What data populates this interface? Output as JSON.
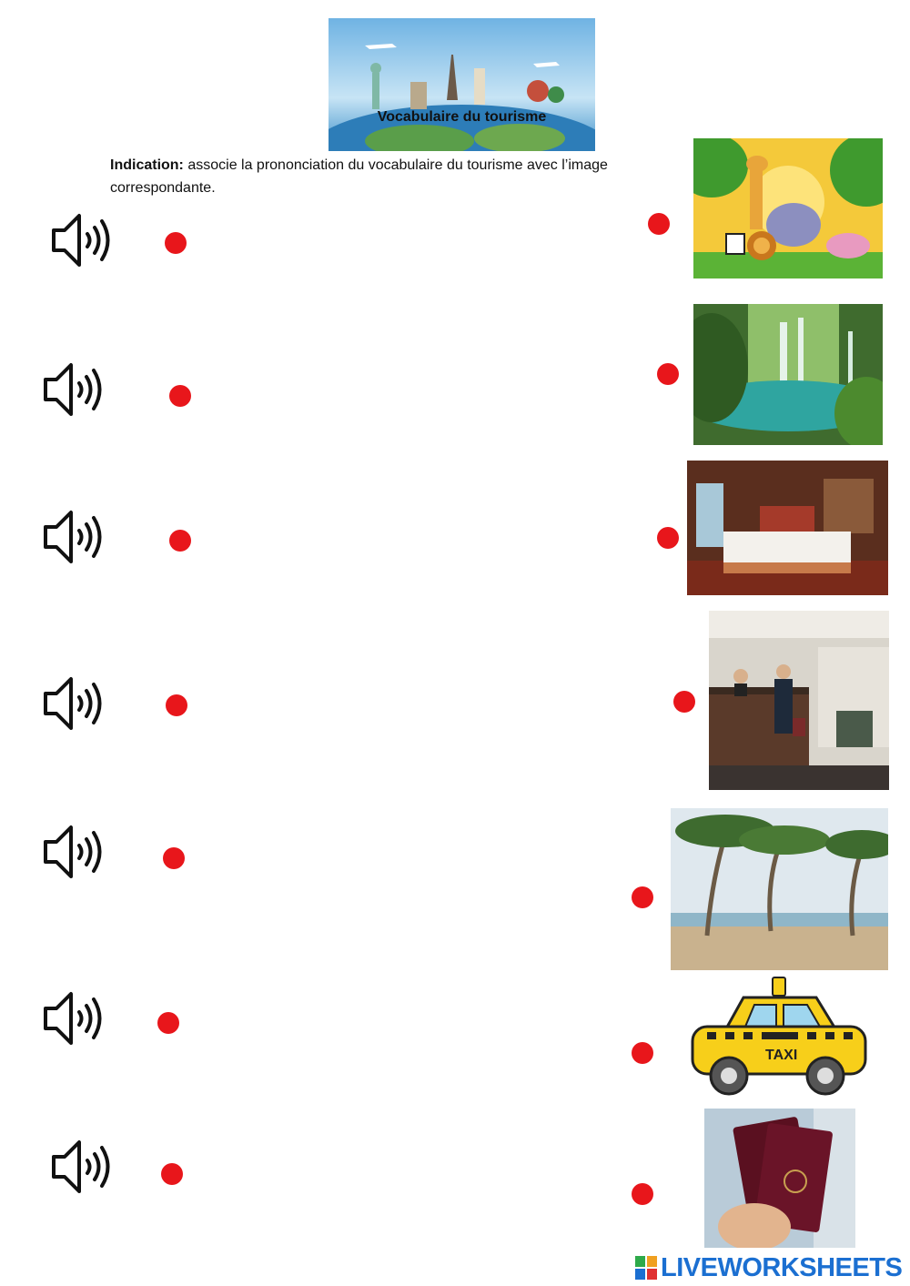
{
  "header": {
    "banner_title": "Vocabulaire du tourisme"
  },
  "instruction": {
    "label": "Indication:",
    "text": " associe la prononciation du vocabulaire du tourisme avec l’image correspondante."
  },
  "audio_items": [
    {
      "icon": "speaker-icon"
    },
    {
      "icon": "speaker-icon"
    },
    {
      "icon": "speaker-icon"
    },
    {
      "icon": "speaker-icon"
    },
    {
      "icon": "speaker-icon"
    },
    {
      "icon": "speaker-icon"
    },
    {
      "icon": "speaker-icon"
    }
  ],
  "images": [
    {
      "subject": "zoo animals"
    },
    {
      "subject": "waterfall lake"
    },
    {
      "subject": "hotel room"
    },
    {
      "subject": "hotel reception"
    },
    {
      "subject": "beach palm trees"
    },
    {
      "subject": "taxi",
      "label": "TAXI"
    },
    {
      "subject": "passports"
    }
  ],
  "colors": {
    "dot": "#e8161b",
    "watermark": "#1b6fd1"
  },
  "watermark": {
    "text": "LIVEWORKSHEETS"
  }
}
